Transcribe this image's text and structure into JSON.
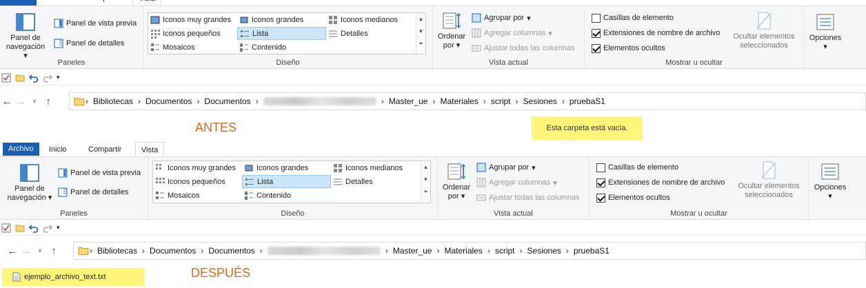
{
  "ribbon": {
    "tabs": [
      "Archivo",
      "Inicio",
      "Compartir",
      "Vista"
    ],
    "panels": {
      "navigation_pane": "Panel de navegación",
      "preview_pane": "Panel de vista previa",
      "details_pane": "Panel de detalles",
      "label": "Paneles"
    },
    "layout": {
      "items": [
        "Iconos muy grandes",
        "Iconos grandes",
        "Iconos medianos",
        "Iconos pequeños",
        "Lista",
        "Detalles",
        "Mosaicos",
        "Contenido"
      ],
      "selected": "Lista",
      "label": "Diseño"
    },
    "current_view": {
      "sort_by": "Ordenar por",
      "group_by": "Agrupar por",
      "add_columns": "Agregar columnas",
      "fit_columns": "Ajustar todas las columnas",
      "label": "Vista actual"
    },
    "show_hide": {
      "item_checkboxes": {
        "label": "Casillas de elemento",
        "checked": false
      },
      "file_extensions": {
        "label": "Extensiones de nombre de archivo",
        "checked": true
      },
      "hidden_items": {
        "label": "Elementos ocultos",
        "checked": true
      },
      "hide_selected": "Ocultar elementos seleccionados",
      "label": "Mostrar u ocultar"
    },
    "options": "Opciones"
  },
  "breadcrumb": [
    "Bibliotecas",
    "Documentos",
    "Documentos",
    "Master_ue",
    "Materiales",
    "script",
    "Sesiones",
    "pruebaS1"
  ],
  "before": {
    "annotation": "ANTES",
    "empty_message": "Esta carpeta está vacía."
  },
  "after": {
    "annotation": "DESPUÉS",
    "file_name": "ejemplo_archivo_text.txt"
  },
  "colors": {
    "accent": "#1a5fb4",
    "annotation": "#e06a1a",
    "highlight": "#fff57a",
    "selection": "#cce4f7"
  }
}
